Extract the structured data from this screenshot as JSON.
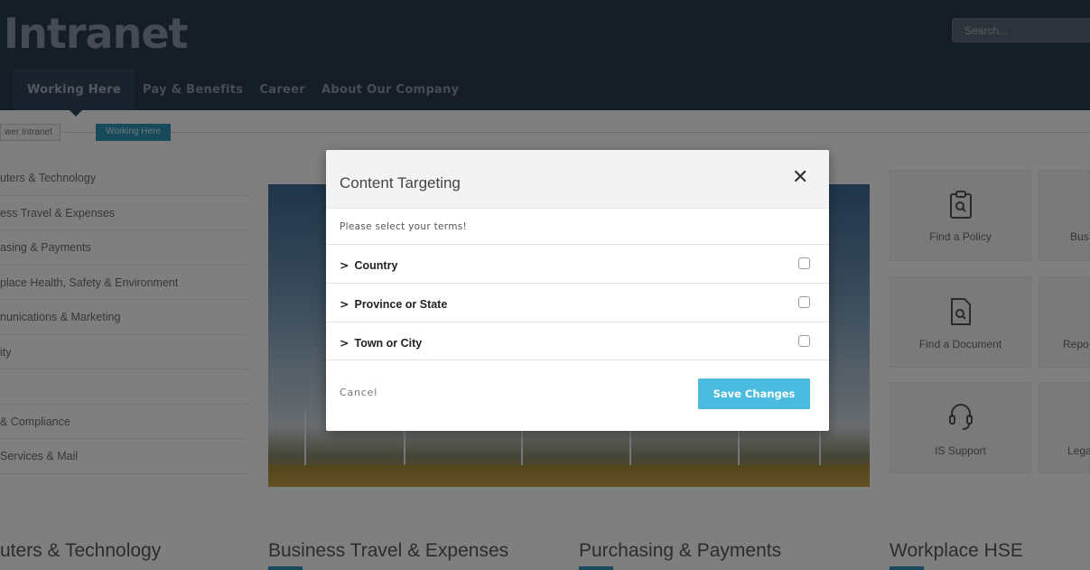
{
  "header": {
    "logo": "Intranet",
    "search_placeholder": "Search...",
    "nav": [
      "Working Here",
      "Pay & Benefits",
      "Career",
      "About Our Company"
    ]
  },
  "breadcrumb": {
    "items": [
      "wer Intranet",
      "Working Here"
    ]
  },
  "sidebar": {
    "items": [
      "uters & Technology",
      "ess Travel & Expenses",
      "asing & Payments",
      "place Health, Safety & Environment",
      "nunications & Marketing",
      "ity",
      "",
      "& Compliance",
      "Services & Mail"
    ]
  },
  "tiles": [
    {
      "label": "Find a Policy",
      "icon": "clipboard-search-icon"
    },
    {
      "label": "Bus",
      "icon": ""
    },
    {
      "label": "Find a Document",
      "icon": "document-search-icon"
    },
    {
      "label": "Repo",
      "icon": ""
    },
    {
      "label": "IS Support",
      "icon": "headset-icon"
    },
    {
      "label": "Lega",
      "icon": ""
    }
  ],
  "sections": [
    "uters & Technology",
    "Business Travel & Expenses",
    "Purchasing & Payments",
    "Workplace HSE"
  ],
  "modal": {
    "title": "Content Targeting",
    "close_glyph": "✕",
    "subtitle": "Please select your terms!",
    "terms": [
      {
        "label": "Country",
        "checked": false
      },
      {
        "label": "Province or State",
        "checked": false
      },
      {
        "label": "Town or City",
        "checked": false
      }
    ],
    "chevron": ">",
    "cancel_label": "Cancel",
    "save_label": "Save Changes"
  },
  "colors": {
    "header_bg": "#2b3b4e",
    "accent": "#2e96b8",
    "save_button": "#4bbbe0"
  }
}
